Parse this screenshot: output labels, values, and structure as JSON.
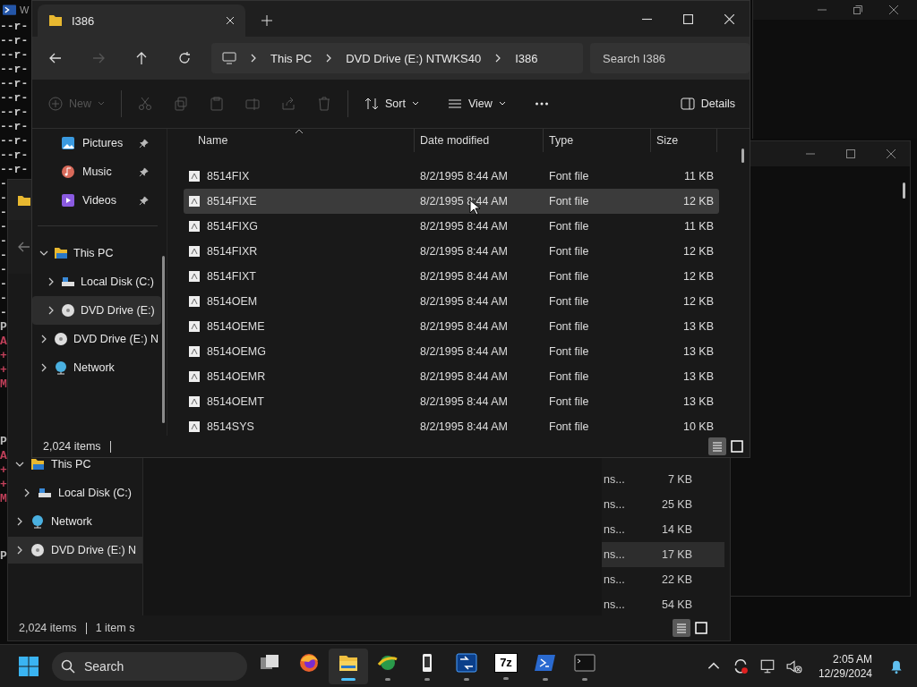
{
  "terminal": {
    "title": "W",
    "line_groups": [
      {
        "lines": [
          {
            "text": "--r-",
            "color": "#cccccc"
          },
          {
            "text": "--r-",
            "color": "#cccccc"
          },
          {
            "text": "--r-",
            "color": "#cccccc"
          },
          {
            "text": "--r-",
            "color": "#cccccc"
          },
          {
            "text": "--r-",
            "color": "#cccccc"
          },
          {
            "text": "--r-",
            "color": "#cccccc"
          },
          {
            "text": "--r-",
            "color": "#cccccc"
          },
          {
            "text": "--r-",
            "color": "#cccccc"
          },
          {
            "text": "--r-",
            "color": "#cccccc"
          },
          {
            "text": "--r-",
            "color": "#cccccc"
          },
          {
            "text": "--r-",
            "color": "#cccccc"
          },
          {
            "text": "-",
            "color": "#cccccc"
          },
          {
            "text": "-",
            "color": "#cccccc"
          },
          {
            "text": "-",
            "color": "#cccccc"
          },
          {
            "text": "-",
            "color": "#cccccc"
          },
          {
            "text": "-",
            "color": "#cccccc"
          },
          {
            "text": "-",
            "color": "#cccccc"
          },
          {
            "text": "-",
            "color": "#cccccc"
          },
          {
            "text": "-",
            "color": "#cccccc"
          },
          {
            "text": "-",
            "color": "#cccccc"
          },
          {
            "text": "-",
            "color": "#cccccc"
          },
          {
            "text": "P",
            "color": "#bbbbbb"
          },
          {
            "text": "A",
            "color": "#c0405a"
          },
          {
            "text": "+",
            "color": "#c0405a"
          },
          {
            "text": "+",
            "color": "#c0405a"
          },
          {
            "text": "M",
            "color": "#c0405a"
          }
        ]
      },
      {
        "lines": [
          {
            "text": "P",
            "color": "#bbbbbb"
          },
          {
            "text": "A",
            "color": "#c0405a"
          },
          {
            "text": "+",
            "color": "#c0405a"
          },
          {
            "text": "+",
            "color": "#c0405a"
          },
          {
            "text": "M",
            "color": "#c0405a"
          }
        ]
      },
      {
        "lines": [
          {
            "text": "P",
            "color": "#bbbbbb"
          }
        ]
      }
    ]
  },
  "explorer_back": {
    "tree": [
      {
        "label": "This PC",
        "kind": "pc",
        "expanded": true,
        "selected": false,
        "children": [
          {
            "label": "Local Disk (C:)",
            "kind": "disk",
            "expanded": false,
            "selected": false
          }
        ]
      },
      {
        "label": "Network",
        "kind": "network",
        "expanded": false,
        "selected": false
      },
      {
        "label": "DVD Drive (E:) N",
        "kind": "dvd",
        "expanded": false,
        "selected": true
      }
    ],
    "rows": [
      {
        "type": "ns...",
        "size": "7 KB",
        "selected": false
      },
      {
        "type": "ns...",
        "size": "25 KB",
        "selected": false
      },
      {
        "type": "ns...",
        "size": "14 KB",
        "selected": false
      },
      {
        "type": "ns...",
        "size": "17 KB",
        "selected": true
      },
      {
        "type": "ns...",
        "size": "22 KB",
        "selected": false
      },
      {
        "type": "ns...",
        "size": "54 KB",
        "selected": false
      }
    ],
    "status": {
      "count": "2,024 items",
      "selection": "1 item s"
    },
    "views": [
      {
        "kind": "details",
        "selected": true
      },
      {
        "kind": "tiles",
        "selected": false
      }
    ]
  },
  "explorer": {
    "tab": {
      "title": "I386"
    },
    "forward_disabled": true,
    "breadcrumbs": [
      "This PC",
      "DVD Drive (E:) NTWKS40",
      "I386"
    ],
    "search": {
      "placeholder": "Search I386"
    },
    "toolbar": [
      {
        "kind": "new",
        "label": "New",
        "disabled": true
      },
      {
        "kind": "cut",
        "disabled": true
      },
      {
        "kind": "copy",
        "disabled": true
      },
      {
        "kind": "paste",
        "disabled": true
      },
      {
        "kind": "rename",
        "disabled": true
      },
      {
        "kind": "share",
        "disabled": true
      },
      {
        "kind": "delete",
        "disabled": true
      },
      {
        "kind": "sort",
        "label": "Sort",
        "disabled": false
      },
      {
        "kind": "view",
        "label": "View",
        "disabled": false
      },
      {
        "kind": "more",
        "disabled": false
      }
    ],
    "details_label": "Details",
    "quick_access": [
      {
        "label": "Pictures",
        "kind": "pictures",
        "pinned": true
      },
      {
        "label": "Music",
        "kind": "music",
        "pinned": true
      },
      {
        "label": "Videos",
        "kind": "videos",
        "pinned": true
      }
    ],
    "tree": [
      {
        "label": "This PC",
        "kind": "pc",
        "expanded": true,
        "selected": false,
        "children": [
          {
            "label": "Local Disk (C:)",
            "kind": "disk",
            "expanded": false,
            "selected": false
          },
          {
            "label": "DVD Drive (E:)",
            "kind": "dvd",
            "expanded": false,
            "selected": true
          }
        ]
      },
      {
        "label": "DVD Drive (E:) N",
        "kind": "dvd",
        "expanded": false,
        "selected": false
      },
      {
        "label": "Network",
        "kind": "network",
        "expanded": false,
        "selected": false
      }
    ],
    "columns": [
      {
        "label": "Name",
        "sorted": true
      },
      {
        "label": "Date modified",
        "sorted": false
      },
      {
        "label": "Type",
        "sorted": false
      },
      {
        "label": "Size",
        "sorted": false
      }
    ],
    "rows": [
      {
        "name": "8514FIX",
        "date": "8/2/1995 8:44 AM",
        "type": "Font file",
        "size": "11 KB",
        "selected": false
      },
      {
        "name": "8514FIXE",
        "date": "8/2/1995 8:44 AM",
        "type": "Font file",
        "size": "12 KB",
        "selected": true
      },
      {
        "name": "8514FIXG",
        "date": "8/2/1995 8:44 AM",
        "type": "Font file",
        "size": "11 KB",
        "selected": false
      },
      {
        "name": "8514FIXR",
        "date": "8/2/1995 8:44 AM",
        "type": "Font file",
        "size": "12 KB",
        "selected": false
      },
      {
        "name": "8514FIXT",
        "date": "8/2/1995 8:44 AM",
        "type": "Font file",
        "size": "12 KB",
        "selected": false
      },
      {
        "name": "8514OEM",
        "date": "8/2/1995 8:44 AM",
        "type": "Font file",
        "size": "12 KB",
        "selected": false
      },
      {
        "name": "8514OEME",
        "date": "8/2/1995 8:44 AM",
        "type": "Font file",
        "size": "13 KB",
        "selected": false
      },
      {
        "name": "8514OEMG",
        "date": "8/2/1995 8:44 AM",
        "type": "Font file",
        "size": "13 KB",
        "selected": false
      },
      {
        "name": "8514OEMR",
        "date": "8/2/1995 8:44 AM",
        "type": "Font file",
        "size": "13 KB",
        "selected": false
      },
      {
        "name": "8514OEMT",
        "date": "8/2/1995 8:44 AM",
        "type": "Font file",
        "size": "13 KB",
        "selected": false
      },
      {
        "name": "8514SYS",
        "date": "8/2/1995 8:44 AM",
        "type": "Font file",
        "size": "10 KB",
        "selected": false
      }
    ],
    "status": {
      "count": "2,024 items"
    },
    "views": [
      {
        "kind": "details",
        "selected": true
      },
      {
        "kind": "tiles",
        "selected": false
      }
    ]
  },
  "taskbar": {
    "search": {
      "placeholder": "Search"
    },
    "apps": [
      {
        "kind": "taskview",
        "running": false,
        "active": false
      },
      {
        "kind": "firefox",
        "running": false,
        "active": false
      },
      {
        "kind": "explorer",
        "running": true,
        "active": true
      },
      {
        "kind": "globe",
        "running": true,
        "active": false
      },
      {
        "kind": "phone",
        "running": true,
        "active": false
      },
      {
        "kind": "remote",
        "running": true,
        "active": false
      },
      {
        "kind": "sevenzip",
        "label": "7z",
        "running": true,
        "active": false
      },
      {
        "kind": "powershell",
        "running": true,
        "active": false
      },
      {
        "kind": "terminal",
        "running": true,
        "active": false
      }
    ],
    "clock": {
      "time": "2:05 AM",
      "date": "12/29/2024"
    }
  }
}
